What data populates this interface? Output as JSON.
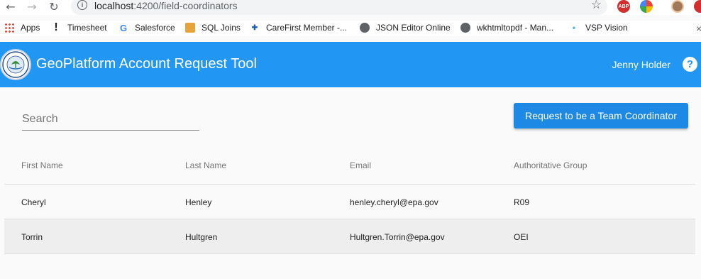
{
  "browser": {
    "url_host": "localhost",
    "url_path": ":4200/field-coordinators",
    "bookmarks": [
      {
        "label": "Apps",
        "icon": "apps-grid-icon"
      },
      {
        "label": "Timesheet",
        "icon": "exclamation-icon"
      },
      {
        "label": "Salesforce",
        "icon": "google-icon"
      },
      {
        "label": "SQL Joins",
        "icon": "sql-joins-icon"
      },
      {
        "label": "CareFirst Member -...",
        "icon": "carefirst-icon"
      },
      {
        "label": "JSON Editor Online",
        "icon": "globe-icon"
      },
      {
        "label": "wkhtmltopdf - Man...",
        "icon": "globe-icon"
      },
      {
        "label": "VSP Vision",
        "icon": "vsp-icon"
      }
    ]
  },
  "header": {
    "title": "GeoPlatform Account Request Tool",
    "user_name": "Jenny Holder",
    "help_glyph": "?",
    "accent_color": "#2196f3"
  },
  "search": {
    "placeholder": "Search",
    "value": ""
  },
  "actions": {
    "request_label": "Request to be a Team Coordinator"
  },
  "table": {
    "columns": [
      "First Name",
      "Last Name",
      "Email",
      "Authoritative Group"
    ],
    "rows": [
      [
        "Cheryl",
        "Henley",
        "henley.cheryl@epa.gov",
        "R09"
      ],
      [
        "Torrin",
        "Hultgren",
        "Hultgren.Torrin@epa.gov",
        "OEI"
      ]
    ]
  }
}
